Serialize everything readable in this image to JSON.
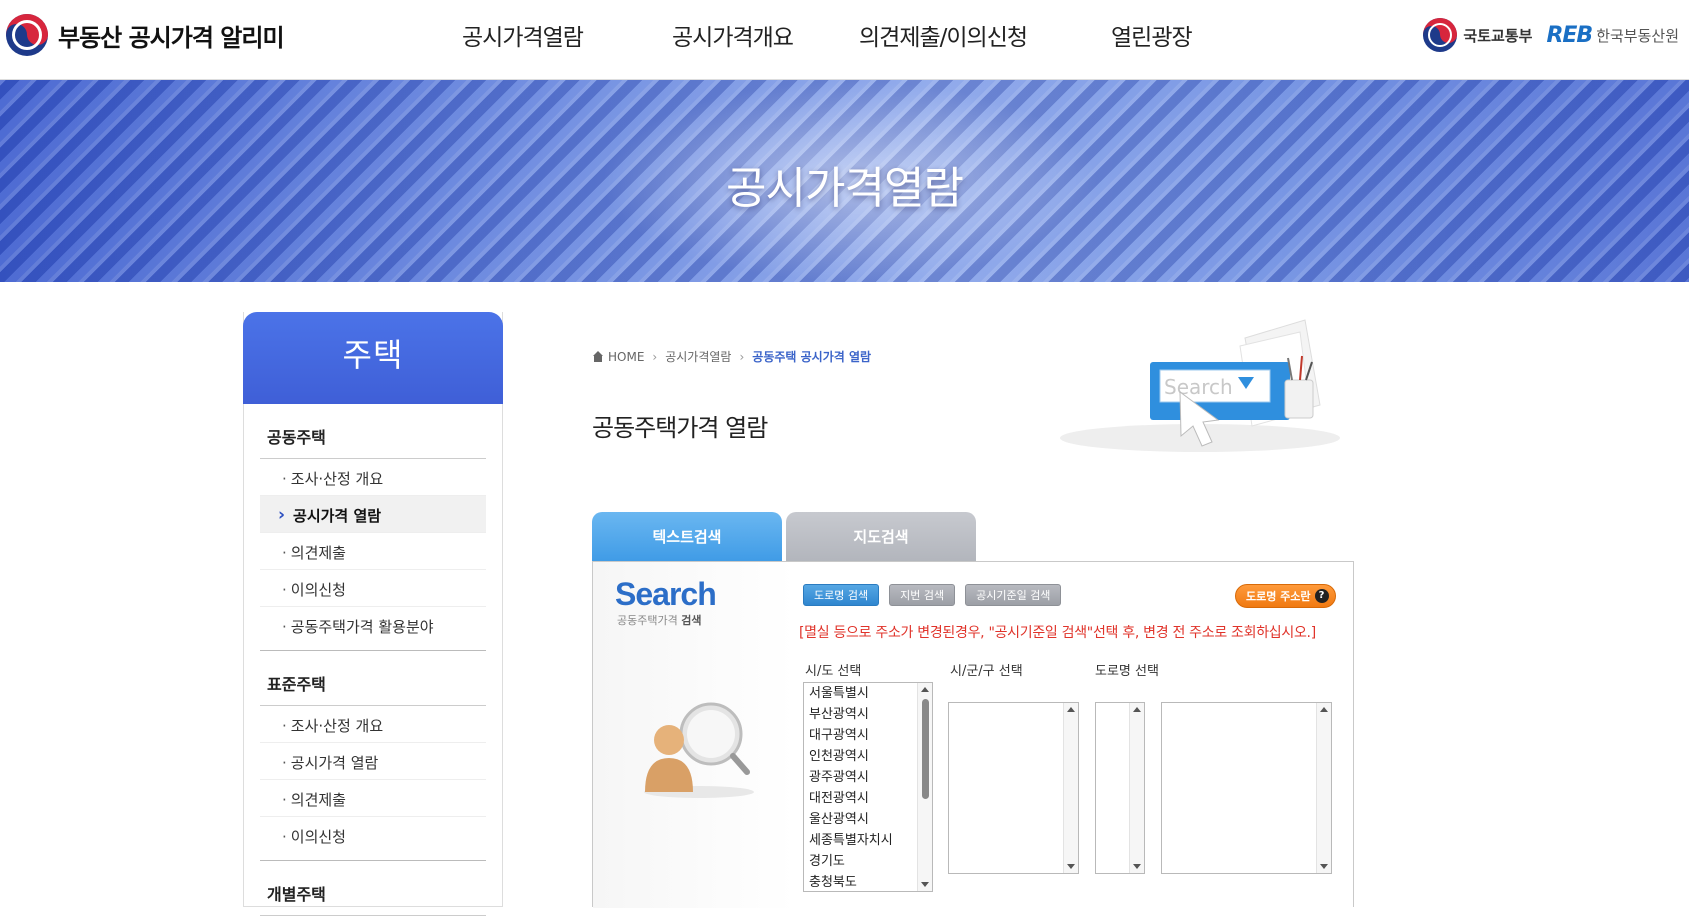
{
  "header": {
    "logo_text_a": "부동산 공시가격",
    "logo_text_b": "알리미",
    "nav": [
      "공시가격열람",
      "공시가격개요",
      "의견제출/이의신청",
      "열린광장"
    ],
    "org_molit": "국토교통부",
    "org_reb_mark": "REB",
    "org_reb_name": "한국부동산원"
  },
  "banner": {
    "title": "공시가격열람"
  },
  "sidebar": {
    "title": "주택",
    "groups": [
      {
        "title": "공동주택",
        "items": [
          "조사·산정 개요",
          "공시가격 열람",
          "의견제출",
          "이의신청",
          "공동주택가격 활용분야"
        ],
        "active_index": 1
      },
      {
        "title": "표준주택",
        "items": [
          "조사·산정 개요",
          "공시가격 열람",
          "의견제출",
          "이의신청"
        ]
      },
      {
        "title": "개별주택",
        "items": []
      }
    ]
  },
  "breadcrumb": {
    "home": "HOME",
    "level1": "공시가격열람",
    "current": "공동주택 공시가격 열람"
  },
  "page_title": "공동주택가격 열람",
  "illustration": {
    "search_word": "Search"
  },
  "tabs": {
    "text_search": "텍스트검색",
    "map_search": "지도검색"
  },
  "search_panel": {
    "logo": "Search",
    "logo_sub_a": "공동주택가격",
    "logo_sub_b": "검색",
    "buttons": [
      "도로명 검색",
      "지번 검색",
      "공시기준일 검색"
    ],
    "road_help": "도로명 주소란",
    "notice": "[멸실 등으로 주소가 변경된경우, \"공시기준일 검색\"선택 후, 변경 전 주소로 조회하십시오.]",
    "labels": {
      "sido": "시/도 선택",
      "sigungu": "시/군/구 선택",
      "road": "도로명 선택"
    },
    "sido_options": [
      "서울특별시",
      "부산광역시",
      "대구광역시",
      "인천광역시",
      "광주광역시",
      "대전광역시",
      "울산광역시",
      "세종특별자치시",
      "경기도",
      "충청북도"
    ]
  },
  "colors": {
    "brand_blue": "#3f5fd7",
    "tab_blue": "#3f9be6",
    "notice_red": "#e0332a",
    "help_orange": "#f07a12"
  }
}
